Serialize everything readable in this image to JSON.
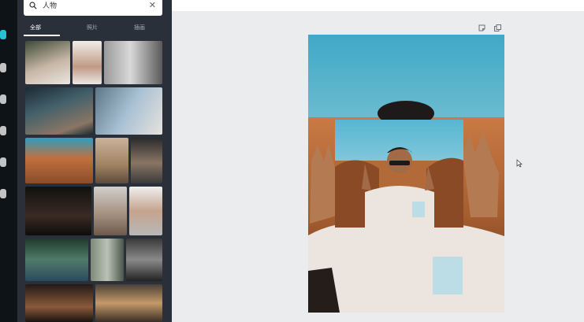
{
  "search": {
    "value": "人物",
    "clear_glyph": "✕"
  },
  "tabs": [
    {
      "label": "全部",
      "active": true
    },
    {
      "label": "照片",
      "active": false
    },
    {
      "label": "插画",
      "active": false
    }
  ],
  "sidebar_rail": {
    "icons": [
      "templates-icon",
      "photos-icon",
      "elements-icon",
      "text-icon",
      "uploads-icon",
      "more-icon"
    ],
    "active_index": 0
  },
  "collapse_glyph": "‹",
  "colors": {
    "rail": "#0e1318",
    "panel": "#293039",
    "accent": "#27c1d6",
    "canvas": "#ebecee",
    "sky": "#6fb9cd"
  }
}
